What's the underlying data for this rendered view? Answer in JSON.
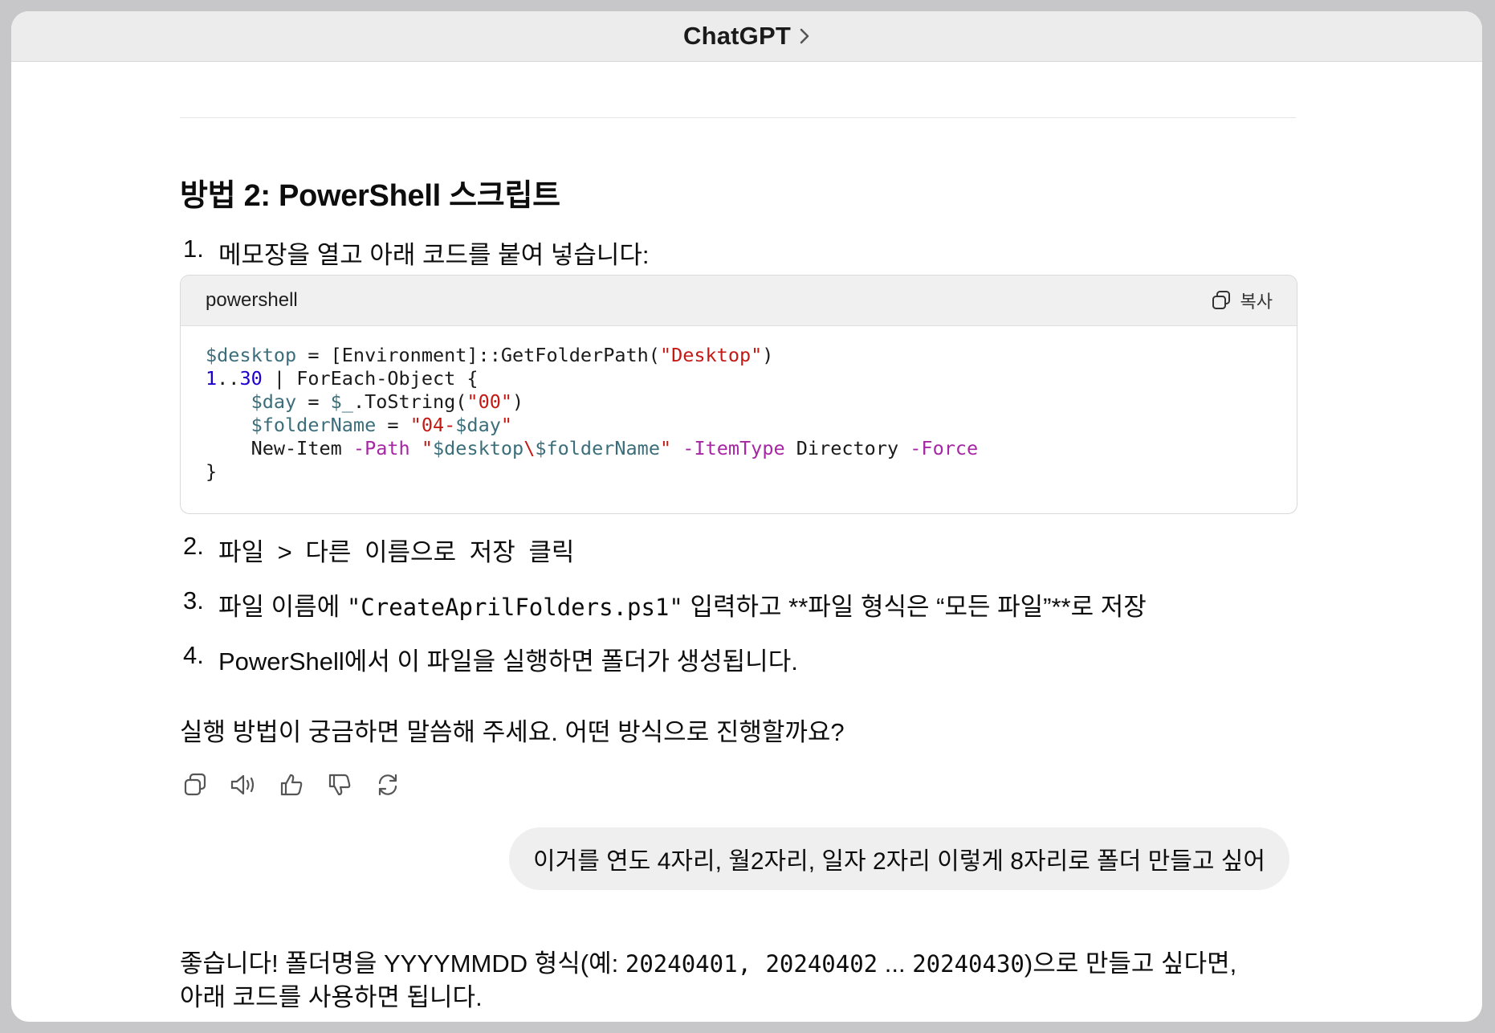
{
  "window": {
    "title": "ChatGPT"
  },
  "assistant": {
    "heading": "방법 2: PowerShell 스크립트",
    "steps": [
      {
        "num": "1.",
        "text": "메모장을 열고 아래 코드를 붙여 넣습니다:"
      },
      {
        "num": "2.",
        "text": "파일 > 다른 이름으로 저장 클릭"
      },
      {
        "num": "3.",
        "pre": "파일 이름에 ",
        "code": "\"CreateAprilFolders.ps1\"",
        "post": " 입력하고 **파일 형식은 “모든 파일”**로 저장"
      },
      {
        "num": "4.",
        "text": "PowerShell에서 이 파일을 실행하면 폴더가 생성됩니다."
      }
    ],
    "code": {
      "language": "powershell",
      "copy_label": "복사",
      "lines": [
        "$desktop = [Environment]::GetFolderPath(\"Desktop\")",
        "1..30 | ForEach-Object {",
        "    $day = $_.ToString(\"00\")",
        "    $folderName = \"04-$day\"",
        "    New-Item -Path \"$desktop\\$folderName\" -ItemType Directory -Force",
        "}"
      ]
    },
    "followup": "실행 방법이 궁금하면 말씀해 주세요. 어떤 방식으로 진행할까요?",
    "actions": [
      "copy-icon",
      "speaker-icon",
      "thumbs-up-icon",
      "thumbs-down-icon",
      "regenerate-icon"
    ]
  },
  "user_message": "이거를 연도 4자리, 월2자리, 일자 2자리 이렇게 8자리로 폴더 만들고 싶어",
  "reply": {
    "line1_pre": "좋습니다! 폴더명을 YYYYMMDD 형식(예: ",
    "line1_code": "20240401, 20240402",
    "line1_mid": " ... ",
    "line1_code2": "20240430",
    "line1_post": ")으로 만들고 싶다면,",
    "line2": "아래 코드를 사용하면 됩니다."
  }
}
